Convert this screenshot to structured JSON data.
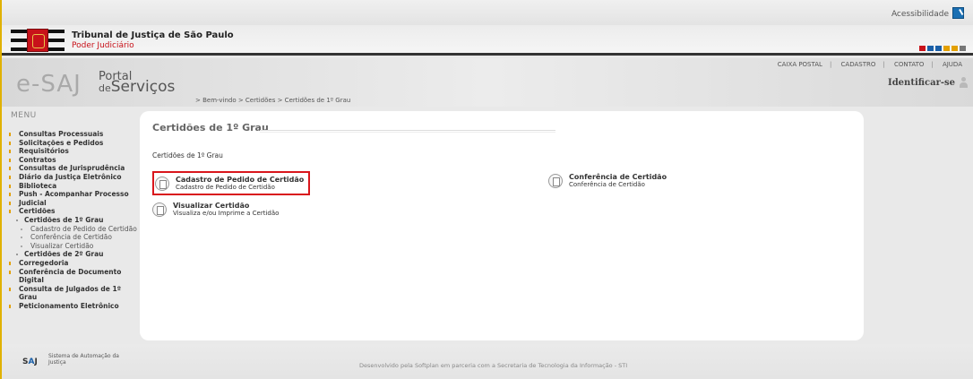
{
  "topbar": {
    "accessibility": "Acessibilidade"
  },
  "header": {
    "title": "Tribunal de Justiça de São Paulo",
    "subtitle": "Poder Judiciário",
    "color_squares": [
      "#c8121a",
      "#1a5fa8",
      "#1a5fa8",
      "#e3a000",
      "#e3a000",
      "#777777"
    ]
  },
  "portal": {
    "logo": "e-SAJ",
    "line1": "Portal",
    "line2_prefix": "de",
    "line2": "Serviços",
    "links": [
      "CAIXA POSTAL",
      "CADASTRO",
      "CONTATO",
      "AJUDA"
    ],
    "identify": "Identificar-se"
  },
  "breadcrumb": "> Bem-vindo > Certidões > Certidões de 1º Grau",
  "menu": {
    "title": "MENU",
    "items": [
      {
        "label": "Consultas Processuais",
        "level": 1
      },
      {
        "label": "Solicitações e Pedidos",
        "level": 1
      },
      {
        "label": "Requisitórios",
        "level": 1
      },
      {
        "label": "Contratos",
        "level": 1
      },
      {
        "label": "Consultas de Jurisprudência",
        "level": 1
      },
      {
        "label": "Diário da Justiça Eletrônico",
        "level": 1
      },
      {
        "label": "Biblioteca",
        "level": 1
      },
      {
        "label": "Push - Acompanhar Processo",
        "level": 1
      },
      {
        "label": "Judicial",
        "level": 1
      },
      {
        "label": "Certidões",
        "level": 1
      },
      {
        "label": "Certidões de 1º Grau",
        "level": 2
      },
      {
        "label": "Cadastro de Pedido de Certidão",
        "level": 3
      },
      {
        "label": "Conferência de Certidão",
        "level": 3
      },
      {
        "label": "Visualizar Certidão",
        "level": 3
      },
      {
        "label": "Certidões de 2º Grau",
        "level": 2
      },
      {
        "label": "Corregedoria",
        "level": 1
      },
      {
        "label": "Conferência de Documento Digital",
        "level": 1
      },
      {
        "label": "Consulta de Julgados de 1º Grau",
        "level": 1
      },
      {
        "label": "Peticionamento Eletrônico",
        "level": 1
      }
    ]
  },
  "content": {
    "title": "Certidões de 1º Grau",
    "section": "Certidões de 1º Grau",
    "cadastro": {
      "title": "Cadastro de Pedido de Certidão",
      "desc": "Cadastro de Pedido de Certidão"
    },
    "conferencia": {
      "title": "Conferência de Certidão",
      "desc": "Conferência de Certidão"
    },
    "visualizar": {
      "title": "Visualizar Certidão",
      "desc": "Visualiza e/ou Imprime a Certidão"
    }
  },
  "footer": {
    "logo_s": "S",
    "logo_a": "A",
    "logo_j": "J",
    "system": "Sistema de Automação da Justiça",
    "credit": "Desenvolvido pela Softplan em parceria com a Secretaria de Tecnologia da Informação - STI"
  }
}
